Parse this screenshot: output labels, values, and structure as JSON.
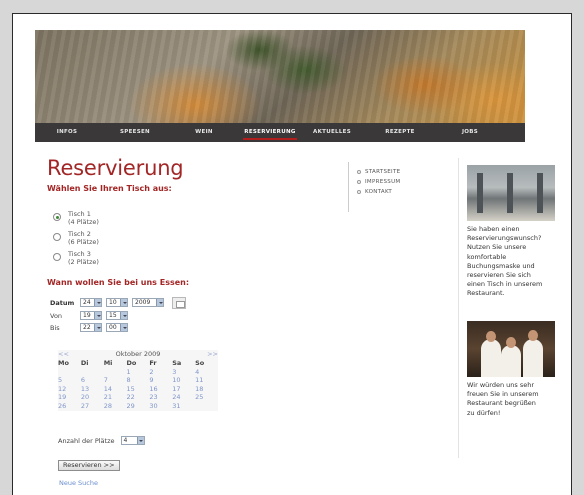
{
  "nav": [
    "INFOS",
    "SPEESEN",
    "WEIN",
    "RESERVIERUNG",
    "AKTUELLES",
    "REZEPTE",
    "JOBS"
  ],
  "page": {
    "title": "Reservierung",
    "table_question": "Wählen Sie Ihren Tisch aus:",
    "tables": [
      {
        "name": "Tisch 1",
        "seats": "(4 Plätze)"
      },
      {
        "name": "Tisch 2",
        "seats": "(6 Plätze)"
      },
      {
        "name": "Tisch 3",
        "seats": "(2 Plätze)"
      }
    ],
    "selected_table": 0,
    "time_question": "Wann wollen Sie bei uns Essen:"
  },
  "form": {
    "date_label": "Datum",
    "date_day": "24",
    "date_month": "10",
    "date_year": "2009",
    "from_label": "Von",
    "from_hour": "19",
    "from_min": "15",
    "to_label": "Bis",
    "to_hour": "22",
    "to_min": "00",
    "seats_label": "Anzahl der Plätze",
    "seats_value": "4",
    "submit_label": "Reservieren >>",
    "new_search": "Neue Suche"
  },
  "calendar": {
    "prev": "<<",
    "next": ">>",
    "month": "Oktober 2009",
    "days": [
      "Mo",
      "Di",
      "Mi",
      "Do",
      "Fr",
      "Sa",
      "So"
    ],
    "cells": [
      "",
      "",
      "",
      "1",
      "2",
      "3",
      "4",
      "5",
      "6",
      "7",
      "8",
      "9",
      "10",
      "11",
      "12",
      "13",
      "14",
      "15",
      "16",
      "17",
      "18",
      "19",
      "20",
      "21",
      "22",
      "23",
      "24",
      "25",
      "26",
      "27",
      "28",
      "29",
      "30",
      "31",
      ""
    ]
  },
  "links": [
    "STARTSEITE",
    "IMPRESSUM",
    "KONTAKT"
  ],
  "side": {
    "text1": [
      "Sie haben einen",
      "Reservierungswunsch?",
      "Nutzen Sie unsere",
      "komfortable",
      "Buchungsmaske und",
      "reservieren Sie sich",
      "einen Tisch in unserem",
      "Restaurant."
    ],
    "text2": [
      "Wir würden uns sehr",
      "freuen Sie in unserem",
      "Restaurant begrüßen",
      "zu dürfen!"
    ]
  },
  "colors": {
    "accent": "#a32626",
    "nav_bg": "#3a3838",
    "link": "#6b8fcf"
  }
}
